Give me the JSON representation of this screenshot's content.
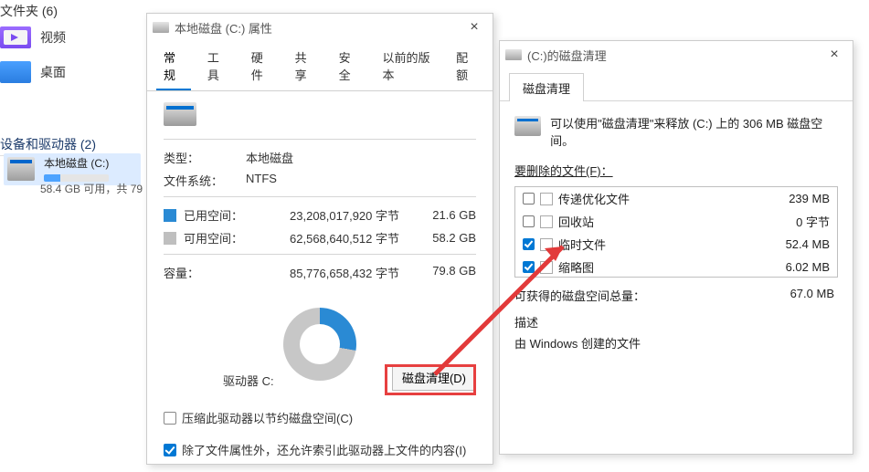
{
  "explorer": {
    "folders_header": "文件夹 (6)",
    "video_label": "视频",
    "desktop_label": "桌面",
    "devices_header": "设备和驱动器 (2)",
    "drive_name": "本地磁盘 (C:)",
    "drive_free": "58.4 GB 可用，共 79"
  },
  "props": {
    "title": "本地磁盘 (C:) 属性",
    "tabs": {
      "general": "常规",
      "tools": "工具",
      "hardware": "硬件",
      "share": "共享",
      "security": "安全",
      "previous": "以前的版本",
      "quota": "配额"
    },
    "type_label": "类型：",
    "type_value": "本地磁盘",
    "fs_label": "文件系统：",
    "fs_value": "NTFS",
    "used_label": "已用空间：",
    "used_bytes": "23,208,017,920 字节",
    "used_gb": "21.6 GB",
    "free_label": "可用空间：",
    "free_bytes": "62,568,640,512 字节",
    "free_gb": "58.2 GB",
    "cap_label": "容量：",
    "cap_bytes": "85,776,658,432 字节",
    "cap_gb": "79.8 GB",
    "drv_letter": "驱动器 C:",
    "cleanup_button": "磁盘清理(D)",
    "compress_label": "压缩此驱动器以节约磁盘空间(C)",
    "index_label": "除了文件属性外，还允许索引此驱动器上文件的内容(I)"
  },
  "clean": {
    "title": "(C:)的磁盘清理",
    "tab": "磁盘清理",
    "hint": "可以使用\"磁盘清理\"来释放  (C:) 上的 306 MB 磁盘空间。",
    "list_label": "要删除的文件(F)：",
    "items": [
      {
        "name": "传递优化文件",
        "size": "239 MB",
        "checked": false
      },
      {
        "name": "回收站",
        "size": "0 字节",
        "checked": false
      },
      {
        "name": "临时文件",
        "size": "52.4 MB",
        "checked": true
      },
      {
        "name": "缩略图",
        "size": "6.02 MB",
        "checked": true
      }
    ],
    "total_label": "可获得的磁盘空间总量：",
    "total_value": "67.0 MB",
    "desc_label": "描述",
    "desc_text": "由 Windows 创建的文件"
  }
}
